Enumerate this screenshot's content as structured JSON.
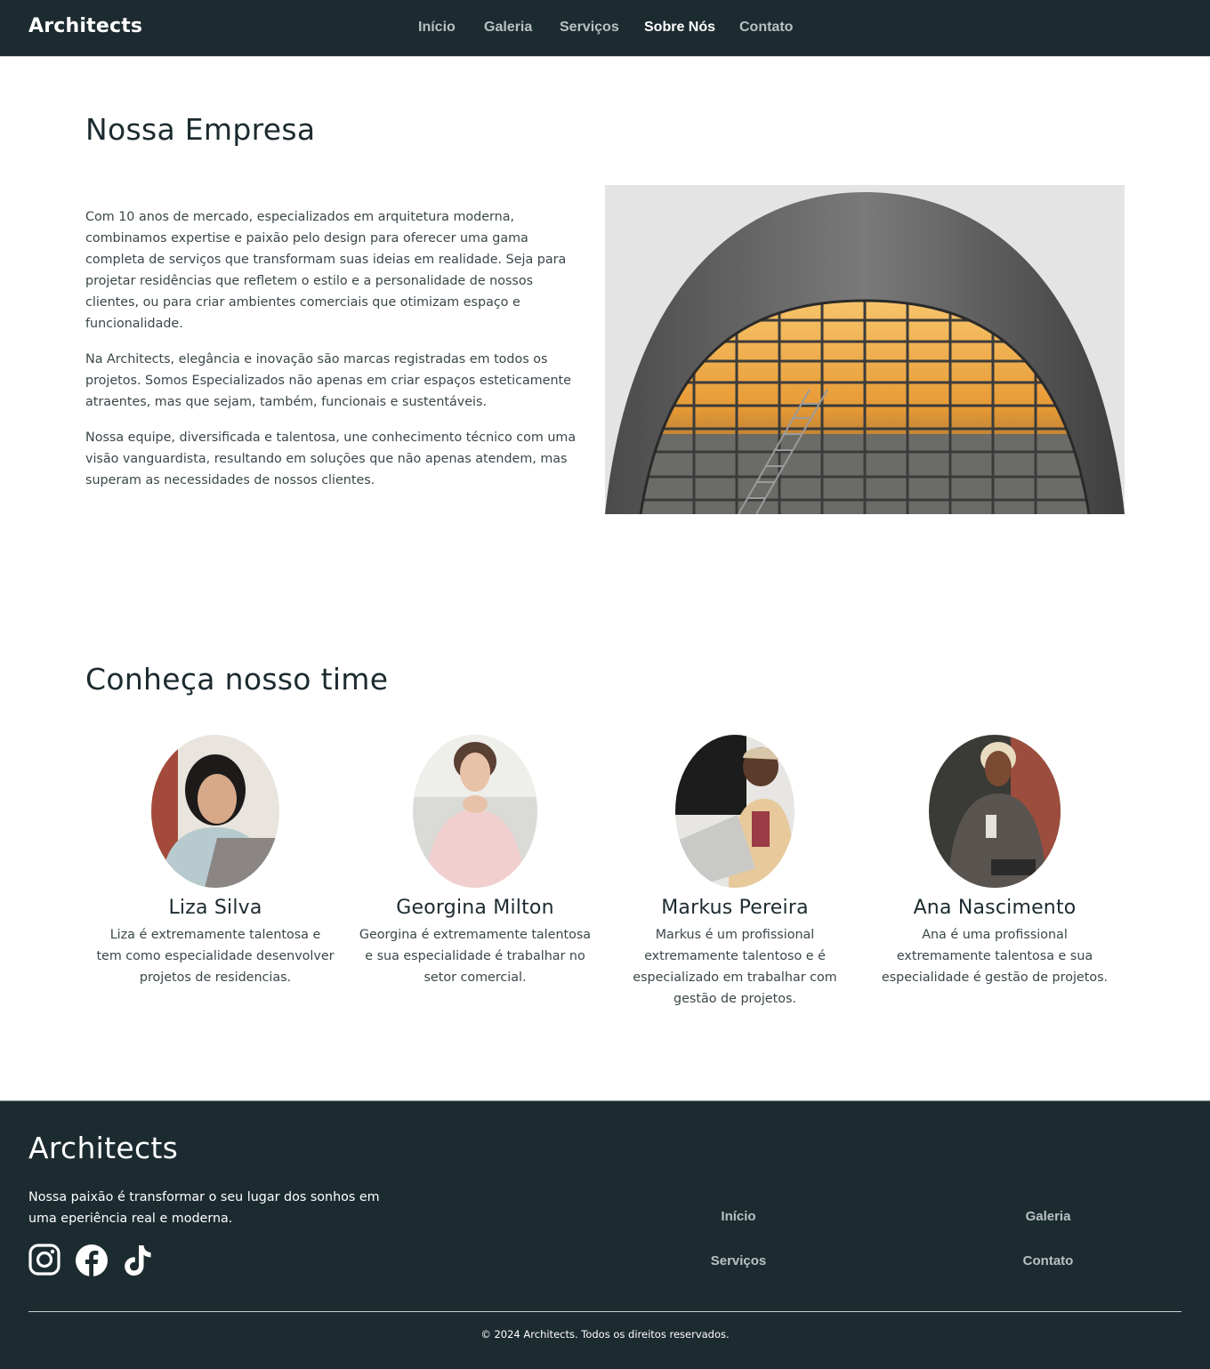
{
  "header": {
    "brand": "Architects",
    "nav": [
      {
        "label": "Início",
        "active": false
      },
      {
        "label": "Galeria",
        "active": false
      },
      {
        "label": "Serviços",
        "active": false
      },
      {
        "label": "Sobre Nós",
        "active": true
      },
      {
        "label": "Contato",
        "active": false
      }
    ]
  },
  "company": {
    "title": "Nossa Empresa",
    "paragraphs": [
      "Com 10 anos de mercado, especializados em arquitetura moderna, combinamos expertise e paixão pelo design para oferecer uma gama completa de serviços que transformam suas ideias em realidade. Seja para projetar residências que refletem o estilo e a personalidade de nossos clientes, ou para criar ambientes comerciais que otimizam espaço e funcionalidade.",
      "Na Architects, elegância e inovação são marcas registradas em todos os projetos. Somos Especializados não apenas em criar espaços esteticamente atraentes, mas que sejam, também, funcionais e sustentáveis.",
      "Nossa equipe, diversificada e talentosa, une conhecimento técnico com uma visão vanguardista, resultando em soluções que não apenas atendem, mas superam as necessidades de nossos clientes."
    ]
  },
  "team": {
    "title": "Conheça nosso time",
    "members": [
      {
        "name": "Liza Silva",
        "bio": "Liza é extremamente talentosa e tem como especialidade desenvolver projetos de residencias."
      },
      {
        "name": "Georgina Milton",
        "bio": "Georgina é extremamente talentosa e sua especialidade é trabalhar no setor comercial."
      },
      {
        "name": "Markus Pereira",
        "bio": "Markus é um profissional extremamente talentoso e é especializado em trabalhar com gestão de projetos."
      },
      {
        "name": "Ana Nascimento",
        "bio": "Ana é uma profissional extremamente talentosa e sua especialidade é gestão de projetos."
      }
    ]
  },
  "footer": {
    "brand": "Architects",
    "tagline": "Nossa paixão é transformar o seu lugar dos sonhos em uma eperiência real e moderna.",
    "socials": [
      "instagram-icon",
      "facebook-icon",
      "tiktok-icon"
    ],
    "links": [
      "Início",
      "Galeria",
      "Serviços",
      "Contato"
    ],
    "copyright": "© 2024 Architects. Todos os direitos reservados."
  },
  "colors": {
    "dark": "#1c2b30",
    "nav_inactive": "#b8c0c3",
    "accent_orange": "#f4a63a"
  }
}
